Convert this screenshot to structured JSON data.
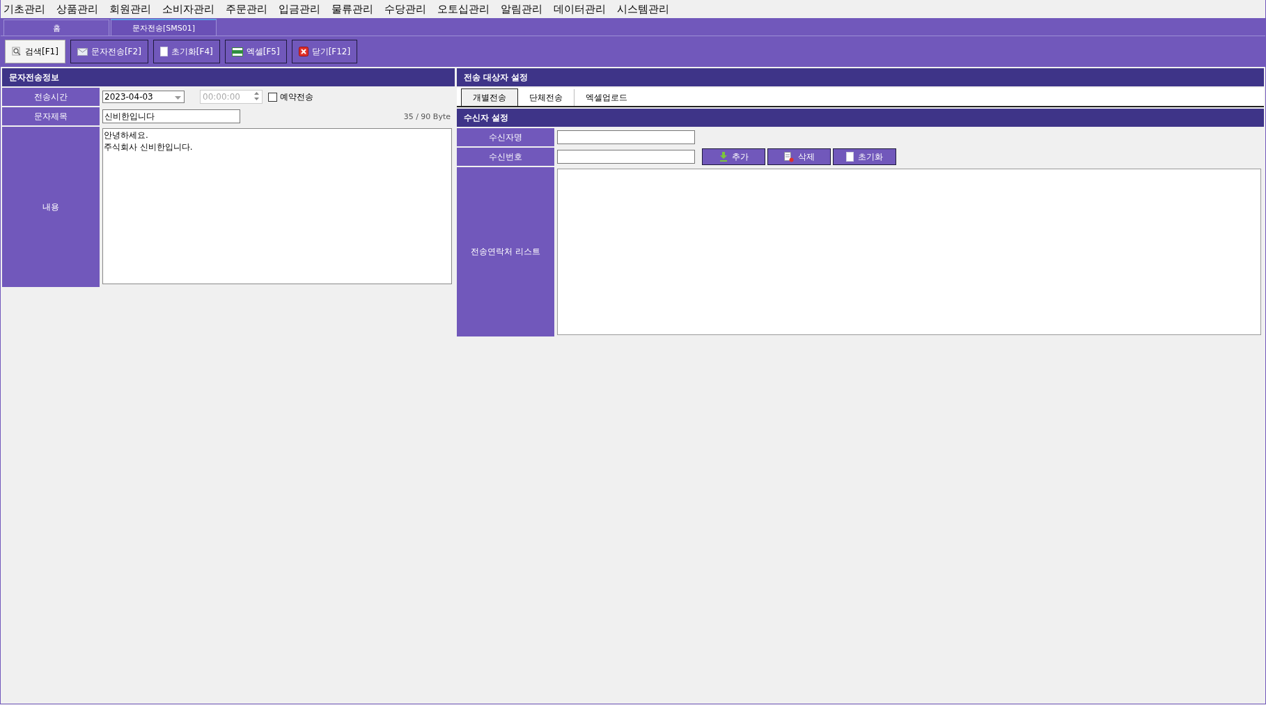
{
  "menu": [
    "기초관리",
    "상품관리",
    "회원관리",
    "소비자관리",
    "주문관리",
    "입금관리",
    "물류관리",
    "수당관리",
    "오토십관리",
    "알림관리",
    "데이터관리",
    "시스템관리"
  ],
  "window_tabs": [
    {
      "label": "홈",
      "selected": false
    },
    {
      "label": "문자전송[SMS01]",
      "selected": true
    }
  ],
  "toolbar": [
    {
      "kind": "search",
      "label": "검색[F1]",
      "selected": true
    },
    {
      "kind": "mail",
      "label": "문자전송[F2]",
      "selected": false
    },
    {
      "kind": "document",
      "label": "초기화[F4]",
      "selected": false
    },
    {
      "kind": "excel",
      "label": "엑셀[F5]",
      "selected": false
    },
    {
      "kind": "close",
      "label": "닫기[F12]",
      "selected": false
    }
  ],
  "message_panel": {
    "title": "문자전송정보",
    "send_time": {
      "label": "전송시간",
      "date": "2023-04-03",
      "time": "00:00:00",
      "time_disabled": true,
      "reserve_label": "예약전송",
      "reserve_checked": false
    },
    "subject": {
      "label": "문자제목",
      "value": "신비한입니다",
      "byte_count": "35 / 90 Byte"
    },
    "content": {
      "label": "내용",
      "value": "안녕하세요.\n주식회사 신비한입니다."
    }
  },
  "recipient_panel": {
    "title": "전송 대상자 설정",
    "tabs": [
      {
        "label": "개별전송",
        "selected": true
      },
      {
        "label": "단체전송",
        "selected": false
      },
      {
        "label": "엑셀업로드",
        "selected": false
      }
    ],
    "section_title": "수신자 설정",
    "name_label": "수신자명",
    "number_label": "수신번호",
    "buttons": [
      {
        "kind": "add",
        "label": "추가"
      },
      {
        "kind": "delete",
        "label": "삭제"
      },
      {
        "kind": "reset",
        "label": "초기화"
      }
    ],
    "list_label": "전송연락처 리스트"
  }
}
